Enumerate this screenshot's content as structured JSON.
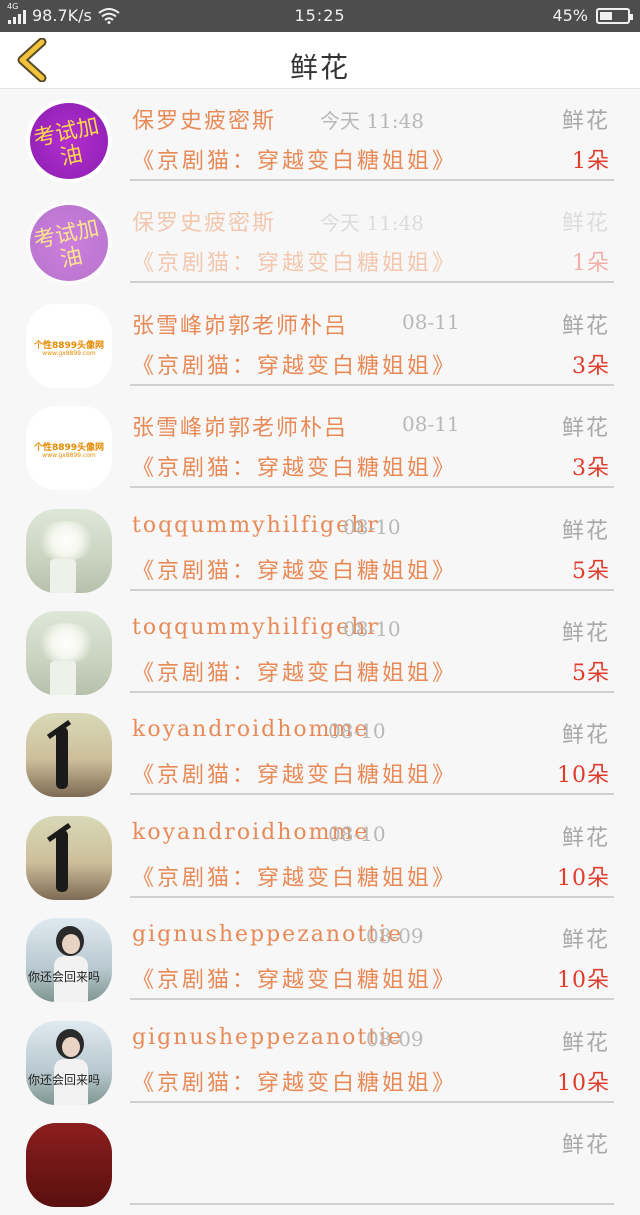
{
  "status": {
    "network": "4G",
    "speed": "98.7K/s",
    "time": "15:25",
    "battery": "45%",
    "battery_level": 0.45
  },
  "navbar": {
    "title": "鲜花"
  },
  "rows": [
    {
      "name": "保罗史疲密斯",
      "time": "今天 11:48",
      "kind": "鲜花",
      "book": "《京剧猫：穿越变白糖姐姐》",
      "count": "1朵",
      "avatar_text": "考试加油"
    },
    {
      "name": "保罗史疲密斯",
      "time": "今天 11:48",
      "kind": "鲜花",
      "book": "《京剧猫：穿越变白糖姐姐》",
      "count": "1朵",
      "avatar_text": "考试加油"
    },
    {
      "name": "张雪峰峁郭老师朴吕",
      "time": "08-11",
      "kind": "鲜花",
      "book": "《京剧猫：穿越变白糖姐姐》",
      "count": "3朵",
      "avatar_text": "个性8899头像网",
      "avatar_sub": "www.gx8899.com"
    },
    {
      "name": "张雪峰峁郭老师朴吕",
      "time": "08-11",
      "kind": "鲜花",
      "book": "《京剧猫：穿越变白糖姐姐》",
      "count": "3朵",
      "avatar_text": "个性8899头像网",
      "avatar_sub": "www.gx8899.com"
    },
    {
      "name": "toqqummyhilfigehr",
      "time": "08-10",
      "kind": "鲜花",
      "book": "《京剧猫：穿越变白糖姐姐》",
      "count": "5朵"
    },
    {
      "name": "toqqummyhilfigehr",
      "time": "08-10",
      "kind": "鲜花",
      "book": "《京剧猫：穿越变白糖姐姐》",
      "count": "5朵"
    },
    {
      "name": "koyandroidhomme",
      "time": "08-10",
      "kind": "鲜花",
      "book": "《京剧猫：穿越变白糖姐姐》",
      "count": "10朵"
    },
    {
      "name": "koyandroidhomme",
      "time": "08-10",
      "kind": "鲜花",
      "book": "《京剧猫：穿越变白糖姐姐》",
      "count": "10朵"
    },
    {
      "name": "gignusheppezanottie",
      "time": "08-09",
      "kind": "鲜花",
      "book": "《京剧猫：穿越变白糖姐姐》",
      "count": "10朵",
      "avatar_text": "你还会回来吗"
    },
    {
      "name": "gignusheppezanottie",
      "time": "08-09",
      "kind": "鲜花",
      "book": "《京剧猫：穿越变白糖姐姐》",
      "count": "10朵",
      "avatar_text": "你还会回来吗"
    },
    {
      "name": "",
      "time": "",
      "kind": "鲜花",
      "book": "",
      "count": ""
    }
  ]
}
